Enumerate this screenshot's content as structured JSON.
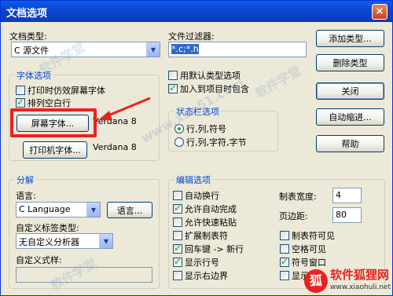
{
  "window": {
    "title": "文档选项",
    "close": "×"
  },
  "doc_type": {
    "label": "文档类型:",
    "value": "C 源文件"
  },
  "file_filter": {
    "label": "文件过滤器:",
    "value": "*.c;*.h"
  },
  "buttons": {
    "add_type": "添加类型...",
    "delete_type": "删除类型",
    "close": "关闭",
    "auto_indent": "自动缩进...",
    "help": "帮助",
    "screen_font": "屏幕字体...",
    "printer_font": "打印机字体...",
    "language": "语言..."
  },
  "font_options": {
    "title": "字体选项",
    "print_emulate": "打印时仿效屏幕字体",
    "arrange_blanks": "排列空白行",
    "screen_font_name": "Verdana 8",
    "printer_font_name": "Verdana 8"
  },
  "misc_checks": {
    "use_default": "用默认类型选项",
    "add_to_project": "加入到项目时包含"
  },
  "status_bar": {
    "title": "状态栏选项",
    "opt1": "行,列,符号",
    "opt2": "行,列,字符,字节"
  },
  "parse": {
    "title": "分解",
    "language_label": "语言:",
    "language_value": "C Language",
    "custom_tag_label": "自定义标签类型:",
    "custom_tag_value": "无自定义分析器",
    "custom_style_label": "自定义式样:"
  },
  "edit_options": {
    "title": "编辑选项",
    "items": [
      "自动换行",
      "允许自动完成",
      "允许快速粘贴",
      "扩展制表符",
      "回车键 -> 新行",
      "显示行号",
      "显示右边界"
    ],
    "tab_width_label": "制表宽度:",
    "tab_width": "4",
    "margin_label": "页边距:",
    "margin": "80",
    "right_items": [
      "制表符可见",
      "空格可见",
      "符号窗口",
      "显示..."
    ]
  },
  "watermarks": [
    "软件学堂",
    "www.xue51.com",
    "软件学堂",
    "软件学堂"
  ],
  "logo": {
    "mark": "狐",
    "name": "软件狐狸网",
    "url": "www.xiaohuli.net"
  }
}
